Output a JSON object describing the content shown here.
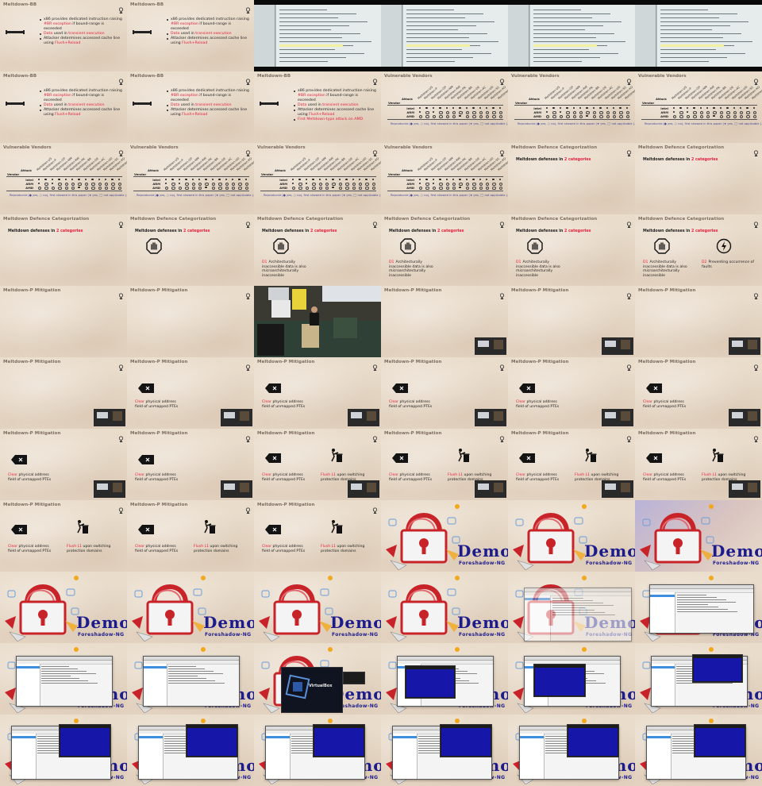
{
  "slides": {
    "meltdown_bb_title": "Meltdown-BB",
    "meltdown_bb_bullets": [
      {
        "pre": "x86 provides dedicated instruction raising ",
        "red": "#BR exception",
        "post": " if bound-range is exceeded"
      },
      {
        "pre": "",
        "red": "Data",
        "post": " used in ",
        "red2": "transient execution"
      },
      {
        "pre": "Attacker determines accessed cache line using ",
        "red": "Flush+Reload",
        "post": ""
      },
      {
        "pre": "",
        "red": "First Meltdown-type attack on AMD",
        "post": ""
      }
    ],
    "vendors_title": "Vulnerable Vendors",
    "vendors_attack_label": "Attack",
    "vendors_vendor_label": "Vendor",
    "vendors_rows": [
      "Intel",
      "ARM",
      "AMD"
    ],
    "vendors_columns": [
      "Meltdown-US",
      "Meltdown-P",
      "Meltdown-GP",
      "Meltdown-NM",
      "Meltdown-RW",
      "Meltdown-PK",
      "Meltdown-BR",
      "Meltdown-DE",
      "Meltdown-AC",
      "Meltdown-UD",
      "Meltdown-SS",
      "Meltdown-XD",
      "Meltdown-SM"
    ],
    "vendors_note": "Reproduced (● yes, ○ no), first showed in this paper (★ yes, ◯ not applicable (-)",
    "defence_title": "Meltdown Defence Categorization",
    "defence_heading_pre": "Meltdown defenses in ",
    "defence_heading_red": "2 categories",
    "d1_label": "D1",
    "d1_text": "Architecturally inaccessible data is also microarchitecturally inaccessible",
    "d2_label": "D2",
    "d2_text": "Preventing occurrence of faults",
    "mitigation_title": "Meltdown-P Mitigation",
    "clear_red": "Clear",
    "clear_text": " physical address field of unmapped PTEs",
    "flush_red": "Flush L1",
    "flush_text": " upon switching protection domains",
    "demo_word": "Demo",
    "demo_sub": "Foreshadow-NG",
    "vbox_name": "VirtualBox"
  },
  "colors": {
    "accent_red": "#e8203c",
    "paper": "#e9dccb",
    "demo_blue": "#1b1b8c",
    "vm_screen": "#1616a8"
  }
}
